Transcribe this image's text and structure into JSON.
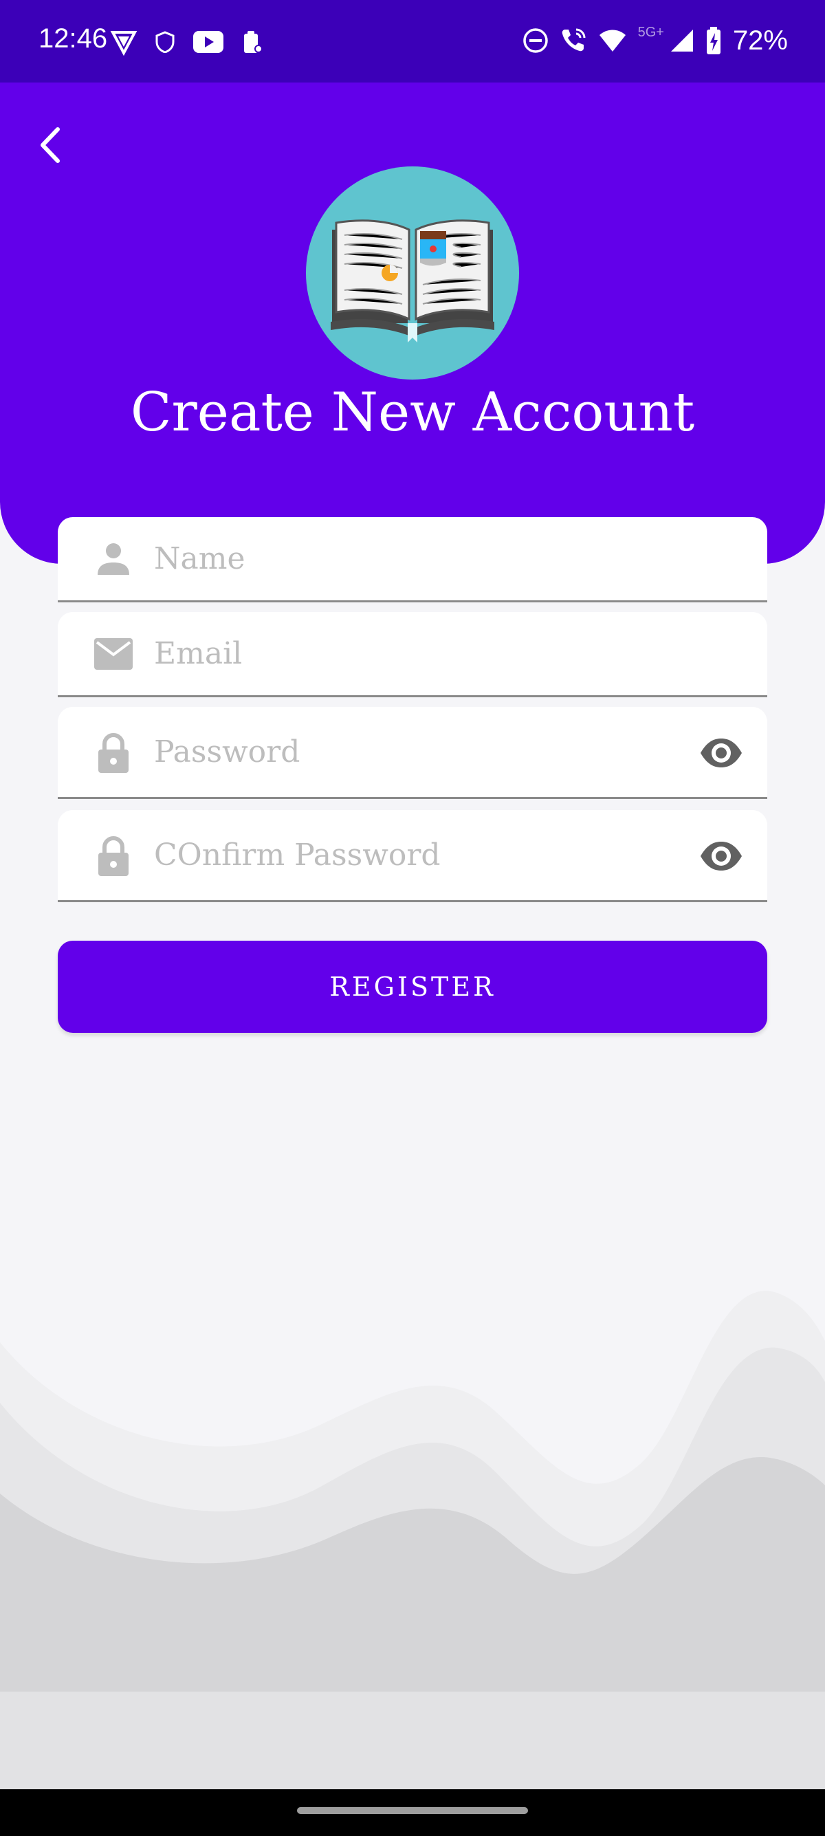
{
  "status_bar": {
    "time": "12:46",
    "network": "5G+",
    "battery": "72%",
    "left_icons": [
      "vpn-shield-icon",
      "shield-icon",
      "youtube-icon",
      "clipboard-icon"
    ],
    "right_icons": [
      "dnd-icon",
      "wifi-calling-icon",
      "wifi-icon",
      "signal-icon",
      "battery-charging-icon"
    ]
  },
  "header": {
    "title": "Create New Account",
    "back_icon": "chevron-left-icon",
    "logo_icon": "open-book-icon",
    "background": "#6200ea"
  },
  "form": {
    "name": {
      "placeholder": "Name",
      "icon": "person-icon",
      "value": ""
    },
    "email": {
      "placeholder": "Email",
      "icon": "mail-icon",
      "value": ""
    },
    "password": {
      "placeholder": "Password",
      "icon": "lock-icon",
      "toggle_icon": "eye-icon",
      "value": ""
    },
    "confirm_password": {
      "placeholder": "COnfirm Password",
      "icon": "lock-icon",
      "toggle_icon": "eye-icon",
      "value": ""
    },
    "register_label": "REGISTER"
  },
  "colors": {
    "accent": "#6200ea",
    "status_bar": "#3c00b8",
    "background": "#f5f5f8"
  }
}
